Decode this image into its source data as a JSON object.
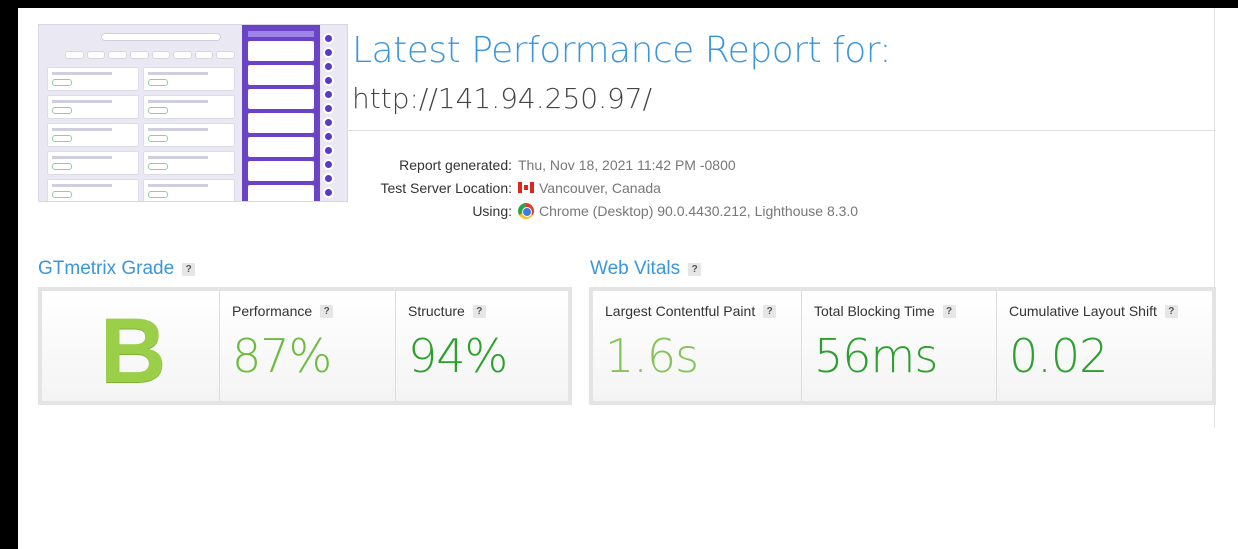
{
  "report": {
    "title": "Latest Performance Report for:",
    "url": "http://141.94.250.97/",
    "meta": [
      {
        "label": "Report generated:",
        "value": "Thu, Nov 18, 2021 11:42 PM -0800",
        "icon": ""
      },
      {
        "label": "Test Server Location:",
        "value": "Vancouver, Canada",
        "icon": "canada-flag-icon"
      },
      {
        "label": "Using:",
        "value": "Chrome (Desktop) 90.0.4430.212, Lighthouse 8.3.0",
        "icon": "chrome-icon"
      }
    ]
  },
  "grade_section": {
    "title": "GTmetrix Grade",
    "help": "?",
    "grade": "B",
    "grade_color": "#9bcf4a",
    "metrics": [
      {
        "label": "Performance",
        "value": "87%",
        "color": "#6dbb3f"
      },
      {
        "label": "Structure",
        "value": "94%",
        "color": "#2ca02c"
      }
    ]
  },
  "vitals_section": {
    "title": "Web Vitals",
    "help": "?",
    "metrics": [
      {
        "label": "Largest Contentful Paint",
        "value": "1.6s",
        "color": "#86c45a"
      },
      {
        "label": "Total Blocking Time",
        "value": "56ms",
        "color": "#2ca02c"
      },
      {
        "label": "Cumulative Layout Shift",
        "value": "0.02",
        "color": "#2ca02c"
      }
    ]
  }
}
